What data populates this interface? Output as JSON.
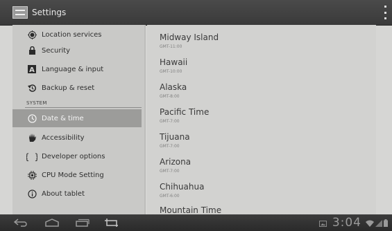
{
  "action_bar": {
    "title": "Settings",
    "app_icon": "settings-icon",
    "overflow_icon": "overflow-menu-icon"
  },
  "sidebar": {
    "items": [
      {
        "label": "Location services",
        "icon": "location-icon"
      },
      {
        "label": "Security",
        "icon": "lock-icon"
      },
      {
        "label": "Language & input",
        "icon": "keyboard-a-icon"
      },
      {
        "label": "Backup & reset",
        "icon": "backup-icon"
      }
    ],
    "section_header": "SYSTEM",
    "system_items": [
      {
        "label": "Date & time",
        "icon": "clock-icon",
        "selected": true
      },
      {
        "label": "Accessibility",
        "icon": "hand-icon"
      },
      {
        "label": "Developer options",
        "icon": "braces-icon"
      },
      {
        "label": "CPU Mode Setting",
        "icon": "chip-icon"
      },
      {
        "label": "About tablet",
        "icon": "info-icon"
      }
    ]
  },
  "timezones": [
    {
      "name": "Midway Island",
      "offset": "GMT-11:00"
    },
    {
      "name": "Hawaii",
      "offset": "GMT-10:00"
    },
    {
      "name": "Alaska",
      "offset": "GMT-8:00"
    },
    {
      "name": "Pacific Time",
      "offset": "GMT-7:00"
    },
    {
      "name": "Tijuana",
      "offset": "GMT-7:00"
    },
    {
      "name": "Arizona",
      "offset": "GMT-7:00"
    },
    {
      "name": "Chihuahua",
      "offset": "GMT-6:00"
    },
    {
      "name": "Mountain Time",
      "offset": ""
    }
  ],
  "nav_bar": {
    "buttons": [
      "back-icon",
      "home-icon",
      "recent-apps-icon",
      "screenshot-icon"
    ],
    "clock": "3:04",
    "status_icons": [
      "gallery-notification-icon",
      "wifi-icon",
      "signal-icon",
      "battery-icon"
    ]
  },
  "colors": {
    "action_bar": "#3f3f3f",
    "selected_item": "#9c9c9a",
    "pane_background": "#d2d2d0"
  }
}
